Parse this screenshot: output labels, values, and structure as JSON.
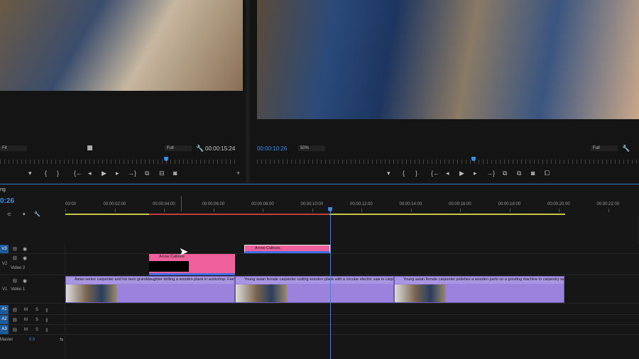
{
  "source_monitor": {
    "zoom": "Fit",
    "quality": "Full",
    "timecode": "00:00:15:24"
  },
  "program_monitor": {
    "timecode": "00:00:10:26",
    "zoom": "50%",
    "quality": "Full"
  },
  "timeline": {
    "sequence_name_fragment": "ng",
    "timecode": "0:26",
    "ruler": [
      "00:00",
      "00:00:02:00",
      "00:00:04:00",
      "00:00:06:00",
      "00:00:08:00",
      "00:00:10:00",
      "00:00:12:00",
      "00:00:14:00",
      "00:00:16:00",
      "00:00:18:00",
      "00:00:20:00",
      "00:00:22:00"
    ],
    "tracks": {
      "v3": "V3",
      "v2": "V2",
      "v2_name": "Video 2",
      "v1": "V1",
      "v1_name": "Video 1",
      "a1": "A1",
      "a2": "A2",
      "a3": "A3",
      "m": "M",
      "s": "S",
      "master": "Master",
      "master_value": "0.0"
    },
    "clips": {
      "v3": "Arrow Callouts",
      "v2": "Arrow Callouts",
      "v1": [
        "Asian senior carpenter and his teen granddaughter drilling a wooden plank in workshop. Family",
        "Young asian female carpenter cutting wooden plank with a circular electric saw in carpentr",
        "Young asian female carpenter polishes a wooden parts on a grinding machine in carpentry works"
      ]
    }
  },
  "colors": {
    "accent": "#3b8ee8",
    "video_clip": "#9b82dc",
    "graphic_clip": "#f0609a"
  }
}
